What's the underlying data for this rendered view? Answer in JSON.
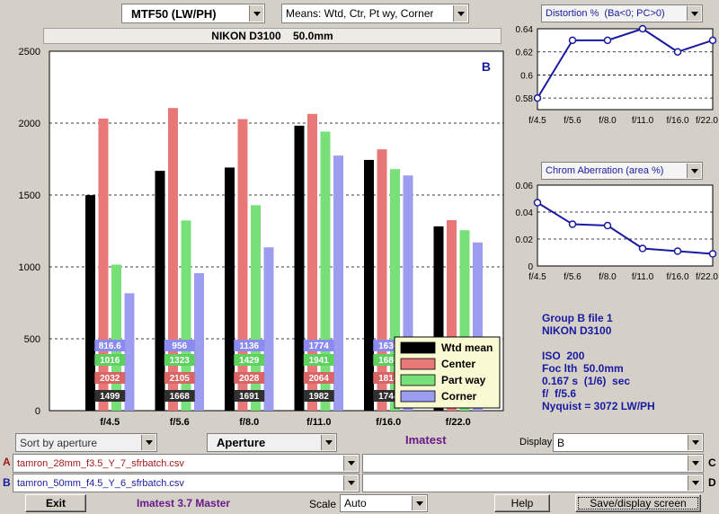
{
  "top": {
    "metric_select": "MTF50 (LW/PH)",
    "means_select": "Means: Wtd, Ctr, Pt wy, Corner",
    "camera_title": "NIKON D3100    50.0mm"
  },
  "chart_data": [
    {
      "type": "bar",
      "group_label": "B",
      "categories": [
        "f/4.5",
        "f/5.6",
        "f/8.0",
        "f/11.0",
        "f/16.0",
        "f/22.0"
      ],
      "ylim": [
        0,
        2500
      ],
      "yticks": [
        "0",
        "500",
        "1000",
        "1500",
        "2000",
        "2500"
      ],
      "series": [
        {
          "name": "Wtd mean",
          "color": "#000000",
          "values": [
            1499,
            1668,
            1691,
            1982,
            1744,
            1282
          ],
          "labels": [
            "1499",
            "1668",
            "1691",
            "1982",
            "1744",
            ""
          ]
        },
        {
          "name": "Center",
          "color": "#e87878",
          "values": [
            2032,
            2105,
            2028,
            2064,
            1818,
            1325
          ],
          "labels": [
            "2032",
            "2105",
            "2028",
            "2064",
            "1818",
            ""
          ]
        },
        {
          "name": "Part way",
          "color": "#78e078",
          "values": [
            1016,
            1323,
            1429,
            1941,
            1680,
            1255
          ],
          "labels": [
            "1016",
            "1323",
            "1429",
            "1941",
            "1680",
            ""
          ]
        },
        {
          "name": "Corner",
          "color": "#9c9cf0",
          "values": [
            816.6,
            956,
            1136,
            1774,
            1636,
            1170
          ],
          "labels": [
            "816.6",
            "956",
            "1136",
            "1774",
            "1636",
            ""
          ]
        }
      ],
      "grid": true,
      "legend": "bottom-right"
    },
    {
      "type": "line",
      "title": "Distortion %  (Ba<0; PC>0)",
      "categories": [
        "f/4.5",
        "f/5.6",
        "f/8.0",
        "f/11.0",
        "f/16.0",
        "f/22.0"
      ],
      "values": [
        0.58,
        0.63,
        0.63,
        0.64,
        0.62,
        0.63
      ],
      "ylim": [
        0.57,
        0.64
      ],
      "yticks": [
        "0.58",
        "0.6",
        "0.62",
        "0.64"
      ],
      "grid": true
    },
    {
      "type": "line",
      "title": "Chrom Aberration (area %)",
      "categories": [
        "f/4.5",
        "f/5.6",
        "f/8.0",
        "f/11.0",
        "f/16.0",
        "f/22.0"
      ],
      "values": [
        0.047,
        0.031,
        0.03,
        0.013,
        0.011,
        0.009
      ],
      "ylim": [
        0,
        0.06
      ],
      "yticks": [
        "0",
        "0.02",
        "0.04",
        "0.06"
      ],
      "grid": true
    }
  ],
  "info": {
    "line1": "Group B file 1",
    "line2": "NIKON D3100",
    "iso": "ISO  200",
    "foc": "Foc lth  50.0mm",
    "exposure": "0.167 s  (1/6)  sec",
    "fstop": "f/  f/5.6",
    "nyquist": "Nyquist = 3072 LW/PH"
  },
  "controls": {
    "sort_select": "Sort by aperture",
    "aperture_button": "Aperture",
    "imatest_label": "Imatest",
    "display_label": "Display",
    "display_select": "B",
    "file_a_letter": "A",
    "file_a": "tamron_28mm_f3.5_Y_7_sfrbatch.csv",
    "file_b_letter": "B",
    "file_b": "tamron_50mm_f4.5_Y_6_sfrbatch.csv",
    "file_c_letter": "C",
    "file_c": "",
    "file_d_letter": "D",
    "file_d": ""
  },
  "bottom": {
    "exit": "Exit",
    "version": "Imatest 3.7 Master",
    "scale_label": "Scale",
    "scale_select": "Auto",
    "help": "Help",
    "save": "Save/display screen"
  }
}
